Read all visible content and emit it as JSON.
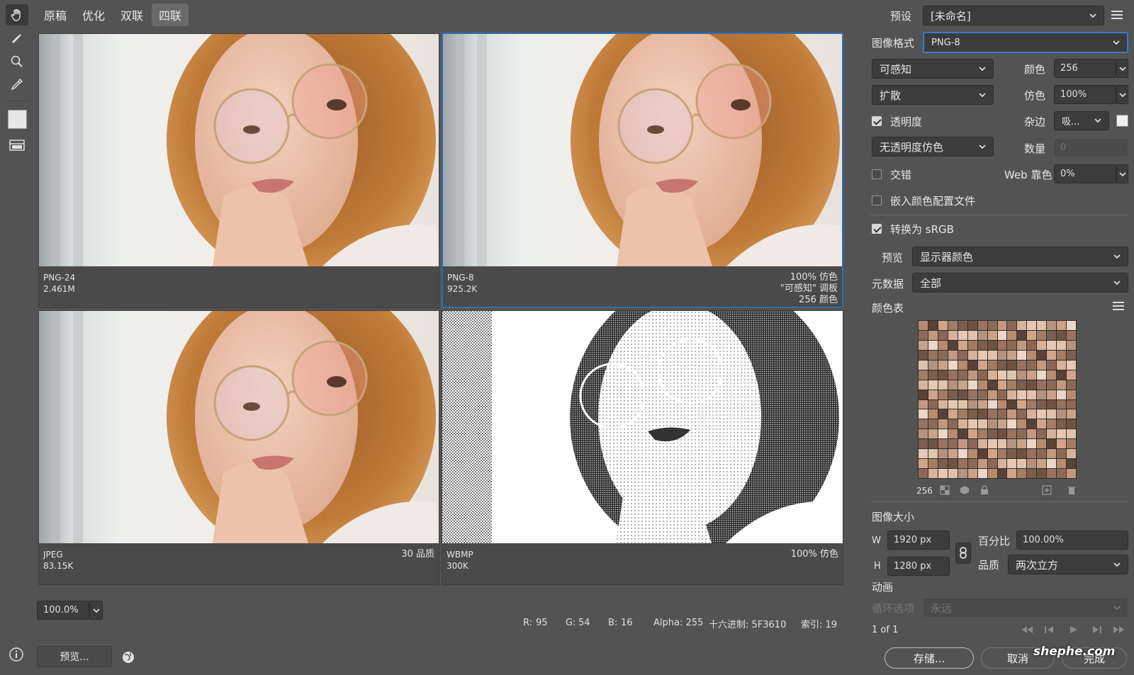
{
  "tabs": [
    {
      "label": "原稿"
    },
    {
      "label": "优化"
    },
    {
      "label": "双联"
    },
    {
      "label": "四联"
    }
  ],
  "panes": {
    "tl": {
      "format": "PNG-24",
      "size": "2.461M"
    },
    "tr": {
      "format": "PNG-8",
      "size": "925.2K",
      "r1": "100% 仿色",
      "r2": "\"可感知\" 调板",
      "r3": "256 颜色"
    },
    "bl": {
      "format": "JPEG",
      "size": "83.15K",
      "r1": "30 品质"
    },
    "br": {
      "format": "WBMP",
      "size": "300K",
      "r1": "100% 仿色"
    }
  },
  "bottom_bar": {
    "zoom": "100.0%",
    "r_label": "R:",
    "r": "95",
    "g_label": "G:",
    "g": "54",
    "b_label": "B:",
    "b": "16",
    "alpha": "Alpha: 255",
    "hex": "十六进制: 5F3610",
    "index": "索引: 19",
    "preview_button": "预览..."
  },
  "panel": {
    "preset_label": "预设",
    "preset_value": "[未命名]",
    "format_label": "图像格式",
    "format_value": "PNG-8",
    "reduction": "可感知",
    "colors_label": "颜色",
    "colors_value": "256",
    "dither_algo": "扩散",
    "dither_label": "仿色",
    "dither_value": "100%",
    "transparency_label": "透明度",
    "matte_label": "杂边",
    "matte_value": "吸...",
    "transparency_dither": "无透明度仿色",
    "amount_label": "数量",
    "amount_value": "0",
    "interlaced_label": "交错",
    "web_snap_label": "Web 靠色",
    "web_snap_value": "0%",
    "embed_profile_label": "嵌入颜色配置文件",
    "srgb_label": "转换为 sRGB",
    "preview_label": "预览",
    "preview_value": "显示器颜色",
    "metadata_label": "元数据",
    "metadata_value": "全部",
    "color_table_label": "颜色表",
    "color_count": "256",
    "image_size_label": "图像大小",
    "w_label": "W",
    "w_value": "1920 px",
    "h_label": "H",
    "h_value": "1280 px",
    "percent_label": "百分比",
    "percent_value": "100.00%",
    "quality_label": "品质",
    "quality_value": "两次立方",
    "animation_label": "动画",
    "loop_label": "循环选项",
    "loop_value": "永远",
    "frame_counter": "1 of 1",
    "save_button": "存储...",
    "cancel_button": "取消",
    "done_button": "完成",
    "watermark": "shephe.com"
  },
  "colors": {
    "accent": "#2f6fb0",
    "bg": "#535353",
    "pane": "#4a4a4a"
  },
  "swatch_colors": [
    "#b88a70",
    "#8c6a58",
    "#caa28a",
    "#6e5242",
    "#e0c2ad",
    "#a47c64",
    "#d9b29b",
    "#5b4035",
    "#c49880",
    "#ecd6c6",
    "#9a7262",
    "#b6937f",
    "#7d5d4d",
    "#e8c7b4",
    "#d2a58b",
    "#8e6656"
  ]
}
